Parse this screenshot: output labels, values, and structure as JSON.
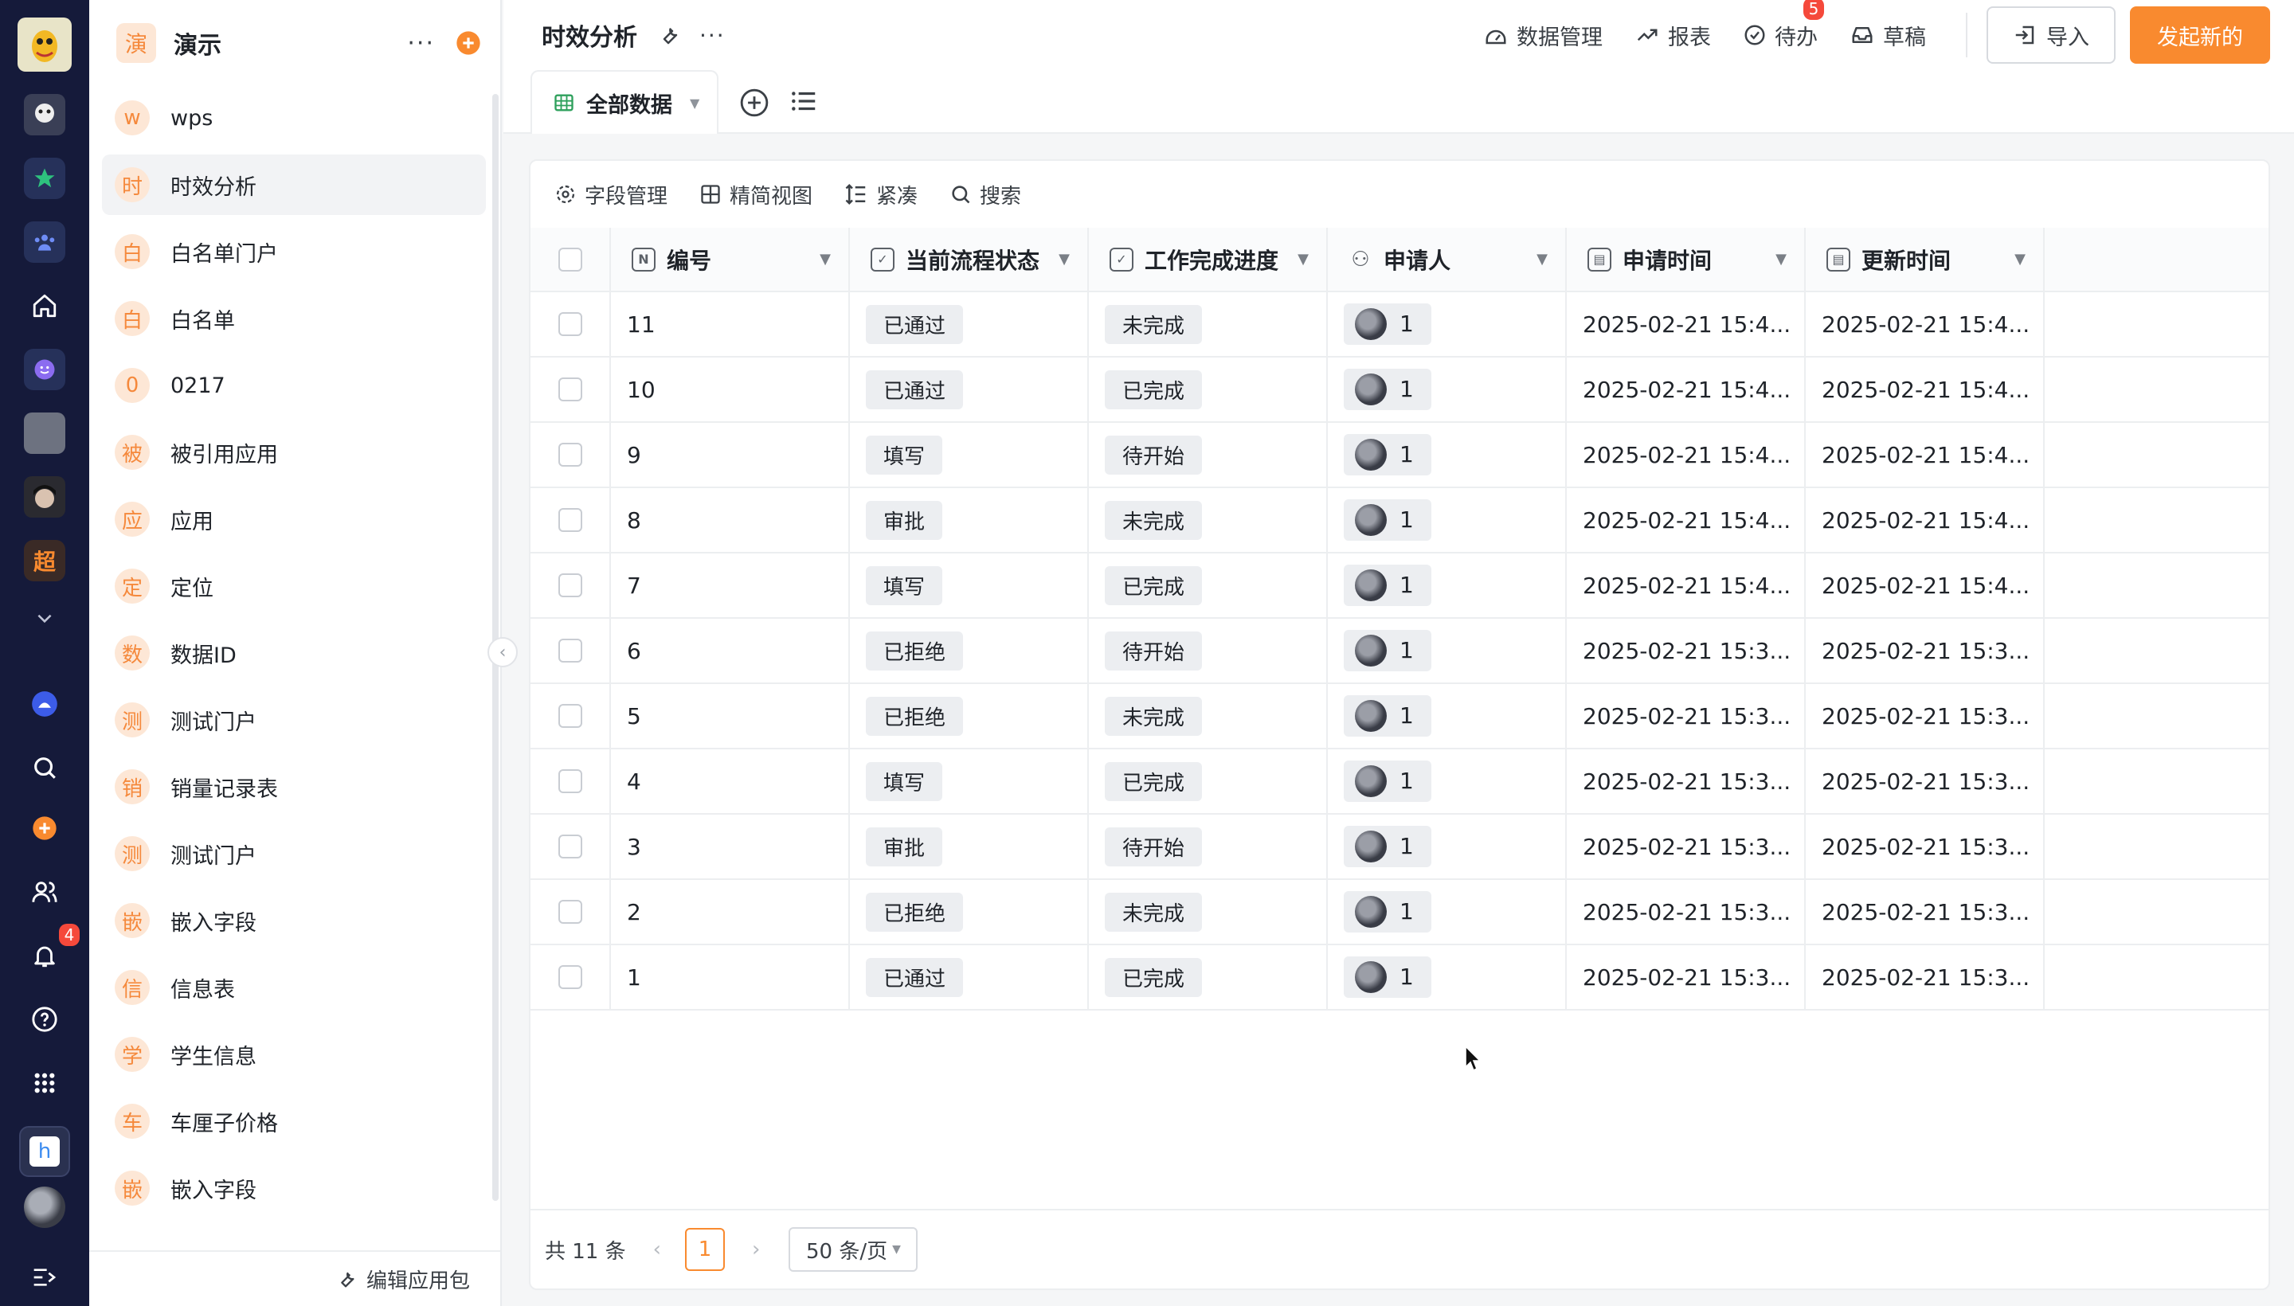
{
  "rail": {
    "notifications_badge": "4",
    "app_letter": "h"
  },
  "sidebar": {
    "app_tag": "演",
    "app_name": "演示",
    "items": [
      {
        "tag": "w",
        "label": "wps"
      },
      {
        "tag": "时",
        "label": "时效分析"
      },
      {
        "tag": "白",
        "label": "白名单门户"
      },
      {
        "tag": "白",
        "label": "白名单"
      },
      {
        "tag": "0",
        "label": "0217"
      },
      {
        "tag": "被",
        "label": "被引用应用"
      },
      {
        "tag": "应",
        "label": "应用"
      },
      {
        "tag": "定",
        "label": "定位"
      },
      {
        "tag": "数",
        "label": "数据ID"
      },
      {
        "tag": "测",
        "label": "测试门户"
      },
      {
        "tag": "销",
        "label": "销量记录表"
      },
      {
        "tag": "测",
        "label": "测试门户"
      },
      {
        "tag": "嵌",
        "label": "嵌入字段"
      },
      {
        "tag": "信",
        "label": "信息表"
      },
      {
        "tag": "学",
        "label": "学生信息"
      },
      {
        "tag": "车",
        "label": "车厘子价格"
      },
      {
        "tag": "嵌",
        "label": "嵌入字段"
      }
    ],
    "footer_label": "编辑应用包"
  },
  "header": {
    "title": "时效分析",
    "data_manage": "数据管理",
    "report": "报表",
    "todo": "待办",
    "todo_badge": "5",
    "draft": "草稿",
    "import": "导入",
    "create": "发起新的"
  },
  "view": {
    "tab_label": "全部数据"
  },
  "toolbar": {
    "fields": "字段管理",
    "compact_view": "精简视图",
    "density": "紧凑",
    "search": "搜索"
  },
  "table": {
    "columns": [
      "编号",
      "当前流程状态",
      "工作完成进度",
      "申请人",
      "申请时间",
      "更新时间"
    ],
    "rows": [
      {
        "id": "11",
        "status": "已通过",
        "progress": "未完成",
        "applicant": "1",
        "applied": "2025-02-21 15:4...",
        "updated": "2025-02-21 15:4..."
      },
      {
        "id": "10",
        "status": "已通过",
        "progress": "已完成",
        "applicant": "1",
        "applied": "2025-02-21 15:4...",
        "updated": "2025-02-21 15:4..."
      },
      {
        "id": "9",
        "status": "填写",
        "progress": "待开始",
        "applicant": "1",
        "applied": "2025-02-21 15:4...",
        "updated": "2025-02-21 15:4..."
      },
      {
        "id": "8",
        "status": "审批",
        "progress": "未完成",
        "applicant": "1",
        "applied": "2025-02-21 15:4...",
        "updated": "2025-02-21 15:4..."
      },
      {
        "id": "7",
        "status": "填写",
        "progress": "已完成",
        "applicant": "1",
        "applied": "2025-02-21 15:4...",
        "updated": "2025-02-21 15:4..."
      },
      {
        "id": "6",
        "status": "已拒绝",
        "progress": "待开始",
        "applicant": "1",
        "applied": "2025-02-21 15:3...",
        "updated": "2025-02-21 15:3..."
      },
      {
        "id": "5",
        "status": "已拒绝",
        "progress": "未完成",
        "applicant": "1",
        "applied": "2025-02-21 15:3...",
        "updated": "2025-02-21 15:3..."
      },
      {
        "id": "4",
        "status": "填写",
        "progress": "已完成",
        "applicant": "1",
        "applied": "2025-02-21 15:3...",
        "updated": "2025-02-21 15:3..."
      },
      {
        "id": "3",
        "status": "审批",
        "progress": "待开始",
        "applicant": "1",
        "applied": "2025-02-21 15:3...",
        "updated": "2025-02-21 15:3..."
      },
      {
        "id": "2",
        "status": "已拒绝",
        "progress": "未完成",
        "applicant": "1",
        "applied": "2025-02-21 15:3...",
        "updated": "2025-02-21 15:3..."
      },
      {
        "id": "1",
        "status": "已通过",
        "progress": "已完成",
        "applicant": "1",
        "applied": "2025-02-21 15:3...",
        "updated": "2025-02-21 15:3..."
      }
    ]
  },
  "pagination": {
    "total": "共 11 条",
    "current_page": "1",
    "page_size": "50 条/页"
  },
  "colors": {
    "accent": "#f98a2f",
    "rail_bg": "#151a3a",
    "badge": "#f5493b"
  }
}
